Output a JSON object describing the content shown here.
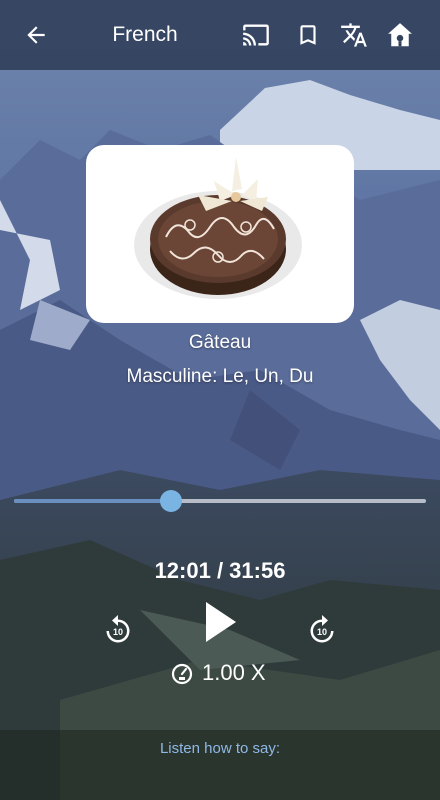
{
  "header": {
    "title": "French",
    "back_icon": "arrow-left-icon",
    "cast_icon": "cast-icon",
    "bookmark_icon": "bookmark-icon",
    "translate_icon": "translate-icon",
    "home_icon": "home-icon"
  },
  "card": {
    "image": "chocolate-cake-image",
    "word": "Gâteau",
    "gender": "Masculine: Le, Un, Du"
  },
  "player": {
    "progress": 0.38,
    "time": "12:01 / 31:56",
    "rewind_label": "10",
    "forward_label": "10",
    "speed": "1.00 X"
  },
  "footer": {
    "listen_label": "Listen how to say:"
  },
  "colors": {
    "topbar": "#32415c",
    "seek_thumb": "#7ab4e3",
    "listen_text": "#8fb8e6"
  }
}
